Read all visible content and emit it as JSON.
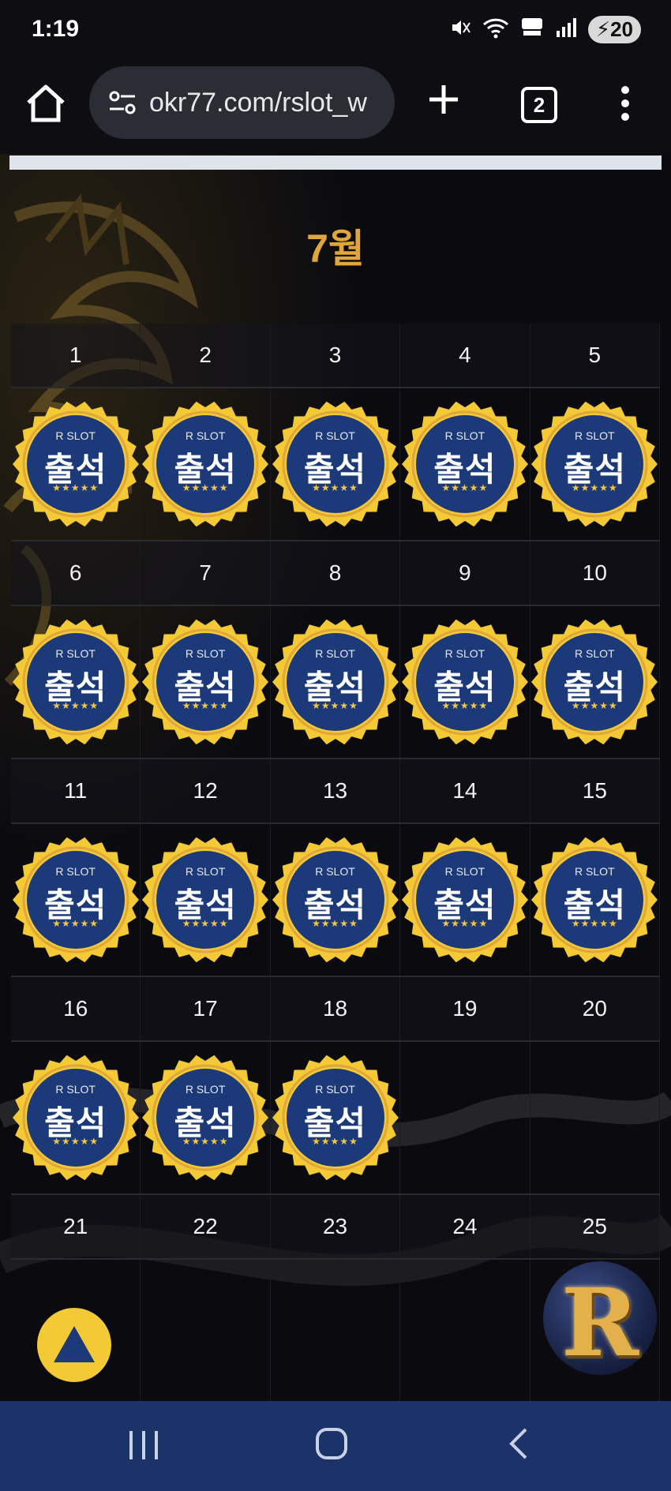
{
  "status_bar": {
    "time": "1:19",
    "battery": "20"
  },
  "browser": {
    "url": "okr77.com/rslot_w",
    "tab_count": "2"
  },
  "calendar": {
    "month": "7월",
    "weeks": [
      {
        "days": [
          "1",
          "2",
          "3",
          "4",
          "5"
        ],
        "stamped": [
          true,
          true,
          true,
          true,
          true
        ]
      },
      {
        "days": [
          "6",
          "7",
          "8",
          "9",
          "10"
        ],
        "stamped": [
          true,
          true,
          true,
          true,
          true
        ]
      },
      {
        "days": [
          "11",
          "12",
          "13",
          "14",
          "15"
        ],
        "stamped": [
          true,
          true,
          true,
          true,
          true
        ]
      },
      {
        "days": [
          "16",
          "17",
          "18",
          "19",
          "20"
        ],
        "stamped": [
          true,
          true,
          true,
          false,
          false
        ]
      },
      {
        "days": [
          "21",
          "22",
          "23",
          "24",
          "25"
        ],
        "stamped": [
          false,
          false,
          false,
          false,
          false
        ]
      }
    ],
    "stamp": {
      "brand": "R SLOT",
      "word": "출석",
      "stars": "★★★★★"
    }
  },
  "floating": {
    "logo_letter": "R"
  },
  "colors": {
    "accent_gold": "#e0a63a",
    "stamp_blue": "#1c3a7a",
    "stamp_ring": "#f3c936",
    "nav_bar": "#1b3368"
  },
  "icons": [
    "home-icon",
    "site-settings-icon",
    "plus-icon",
    "menu-icon",
    "triangle-up-icon",
    "recent-apps-icon",
    "nav-home-icon",
    "back-icon"
  ]
}
